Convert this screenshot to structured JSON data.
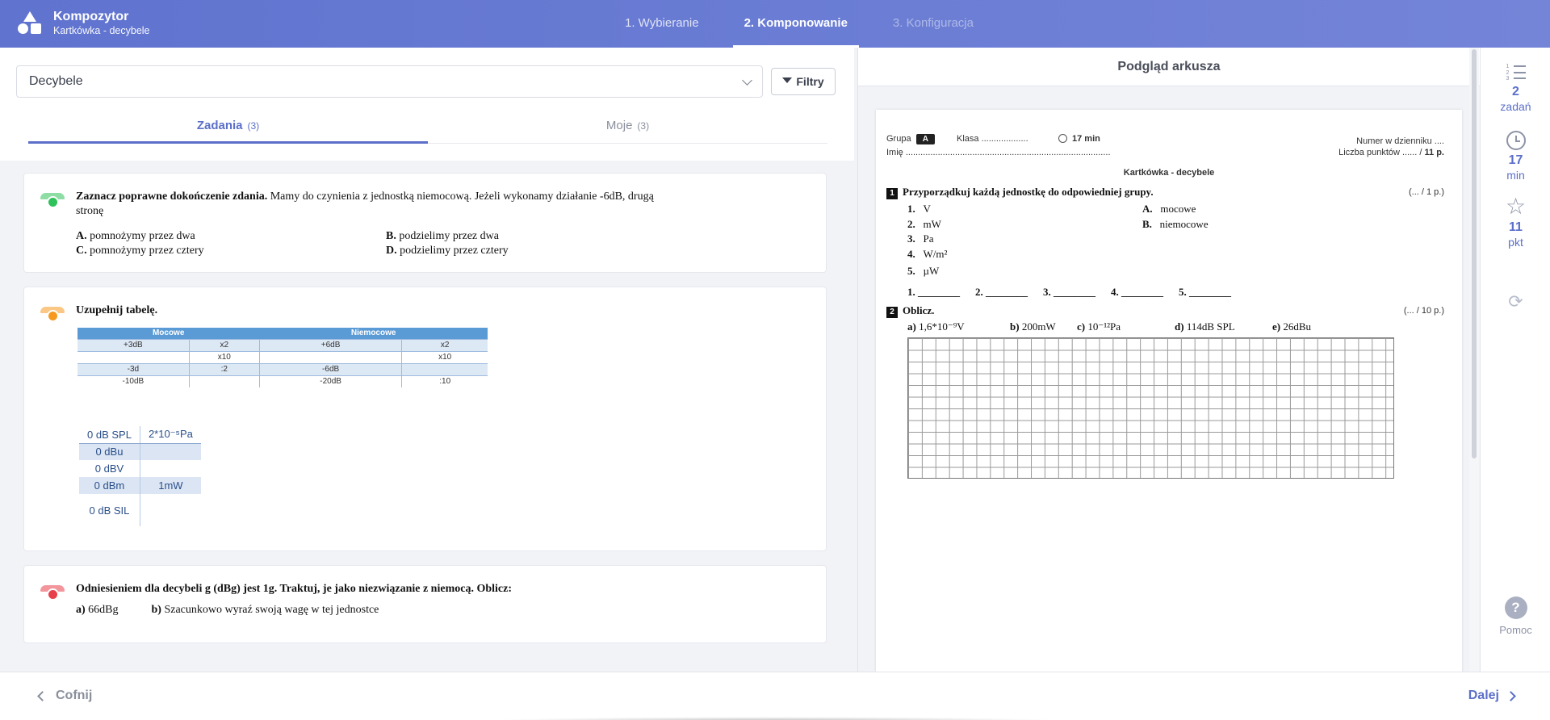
{
  "header": {
    "app_title": "Kompozytor",
    "subtitle": "Kartkówka - decybele",
    "steps": [
      {
        "label": "1. Wybieranie",
        "state": "done"
      },
      {
        "label": "2. Komponowanie",
        "state": "active"
      },
      {
        "label": "3. Konfiguracja",
        "state": "disabled"
      }
    ]
  },
  "left": {
    "topic_select": {
      "value": "Decybele"
    },
    "filters_label": "Filtry",
    "tabs": [
      {
        "label": "Zadania",
        "count": "(3)",
        "active": true
      },
      {
        "label": "Moje",
        "count": "(3)",
        "active": false
      }
    ],
    "q1": {
      "difficulty_color": "#2fc15a",
      "bold": "Zaznacz poprawne dokończenie zdania.",
      "text": " Mamy do czynienia z jednostką niemocową. Jeżeli wykonamy działanie -6dB, drugą",
      "text2": "stronę",
      "answers": [
        {
          "letter": "A.",
          "text": "pomnożymy przez dwa"
        },
        {
          "letter": "B.",
          "text": "podzielimy przez dwa"
        },
        {
          "letter": "C.",
          "text": "pomnożymy przez cztery"
        },
        {
          "letter": "D.",
          "text": "podzielimy przez cztery"
        }
      ]
    },
    "q2": {
      "difficulty_color": "#f59a1f",
      "title": "Uzupełnij tabelę.",
      "table1": {
        "headers": [
          "Mocowe",
          "Niemocowe"
        ],
        "rows": [
          [
            "+3dB",
            "x2",
            "+6dB",
            "x2"
          ],
          [
            "",
            "x10",
            "",
            "x10"
          ],
          [
            "-3d",
            ":2",
            "-6dB",
            ""
          ],
          [
            "-10dB",
            "",
            "-20dB",
            ":10"
          ]
        ]
      },
      "table2": {
        "rows": [
          [
            "0 dB SPL",
            "2*10⁻⁵Pa"
          ],
          [
            "0 dBu",
            ""
          ],
          [
            "0 dBV",
            ""
          ],
          [
            "0 dBm",
            "1mW"
          ],
          [
            "0 dB SIL",
            ""
          ]
        ]
      }
    },
    "q3": {
      "difficulty_color": "#e8404a",
      "bold": "Odniesieniem dla decybeli g (dBg) jest 1g. Traktuj, je jako niezwiązanie z niemocą. Oblicz:",
      "parts": [
        {
          "letter": "a)",
          "text": "66dBg"
        },
        {
          "letter": "b)",
          "text": "Szacunkowo wyraź swoją wagę w tej jednostce"
        }
      ]
    }
  },
  "preview": {
    "title": "Podgląd arkusza",
    "grupa_label": "Grupa",
    "grupa_value": "A",
    "klasa_label": "Klasa ...................",
    "time": "17 min",
    "numer_label": "Numer w dzienniku ....",
    "imie_label": "Imię ...................................................................................",
    "punkty_label": "Liczba punktów ...... /",
    "punkty_value": "11 p.",
    "sheet_title": "Kartkówka - decybele",
    "task1": {
      "num": "1",
      "title": "Przyporządkuj każdą jednostkę do odpowiedniej grupy.",
      "points": "(... / 1 p.)",
      "items": [
        {
          "n": "1.",
          "t": "V"
        },
        {
          "n": "2.",
          "t": "mW"
        },
        {
          "n": "3.",
          "t": "Pa"
        },
        {
          "n": "4.",
          "t": "W/m²"
        },
        {
          "n": "5.",
          "t": "µW"
        }
      ],
      "groups": [
        {
          "n": "A.",
          "t": "mocowe"
        },
        {
          "n": "B.",
          "t": "niemocowe"
        }
      ],
      "blanks": [
        "1. ________",
        "2. ________",
        "3. ________",
        "4. ________",
        "5. ________"
      ]
    },
    "task2": {
      "num": "2",
      "title": "Oblicz.",
      "points": "(... / 10 p.)",
      "parts": [
        {
          "l": "a)",
          "t": "1,6*10⁻⁹V"
        },
        {
          "l": "b)",
          "t": "200mW"
        },
        {
          "l": "c)",
          "t": "10⁻¹²Pa"
        },
        {
          "l": "d)",
          "t": "114dB SPL"
        },
        {
          "l": "e)",
          "t": "26dBu"
        }
      ]
    }
  },
  "rail": {
    "tasks": {
      "value": "2",
      "unit": "zadań"
    },
    "time": {
      "value": "17",
      "unit": "min"
    },
    "points": {
      "value": "11",
      "unit": "pkt"
    },
    "help": "Pomoc"
  },
  "footer": {
    "back": "Cofnij",
    "next": "Dalej"
  }
}
